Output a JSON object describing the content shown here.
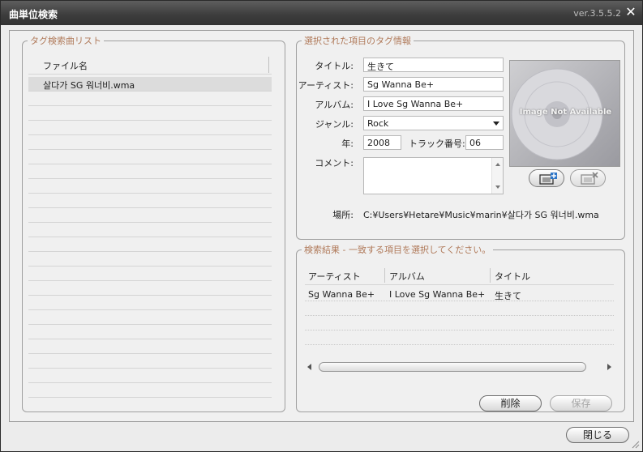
{
  "window": {
    "title": "曲単位検索",
    "version": "ver.3.5.5.2"
  },
  "file_list": {
    "legend": "タグ検索曲リスト",
    "column_header": "ファイル名",
    "items": [
      "살다가 SG 워너비.wma",
      "",
      "",
      "",
      "",
      "",
      "",
      "",
      "",
      "",
      "",
      "",
      "",
      "",
      "",
      "",
      "",
      "",
      "",
      "",
      "",
      ""
    ]
  },
  "tag_info": {
    "legend": "選択された項目のタグ情報",
    "title_label": "タイトル:",
    "title_value": "生きて",
    "artist_label": "アーティスト:",
    "artist_value": "Sg Wanna Be+",
    "album_label": "アルバム:",
    "album_value": "I Love Sg Wanna Be+",
    "genre_label": "ジャンル:",
    "genre_value": "Rock",
    "year_label": "年:",
    "year_value": "2008",
    "track_label": "トラック番号:",
    "track_value": "06",
    "comment_label": "コメント:",
    "comment_value": "",
    "location_label": "場所:",
    "location_value": "C:¥Users¥Hetare¥Music¥marin¥살다가 SG 워너비.wma",
    "art_placeholder": "Image Not Available",
    "art_add_icon": "add-picture-icon",
    "art_remove_icon": "remove-picture-icon"
  },
  "results": {
    "legend": "検索結果 - 一致する項目を選択してください。",
    "columns": [
      "アーティスト",
      "アルバム",
      "タイトル"
    ],
    "rows": [
      [
        "Sg Wanna Be+",
        "I Love Sg Wanna Be+",
        "生きて"
      ],
      [
        "",
        "",
        ""
      ],
      [
        "",
        "",
        ""
      ],
      [
        "",
        "",
        ""
      ]
    ],
    "delete_label": "削除",
    "save_label": "保存"
  },
  "footer": {
    "close_label": "閉じる"
  },
  "colors": {
    "legend": "#b07a5a",
    "titlebar": "#3c3c3c",
    "selected_row": "#dcdcdc"
  }
}
